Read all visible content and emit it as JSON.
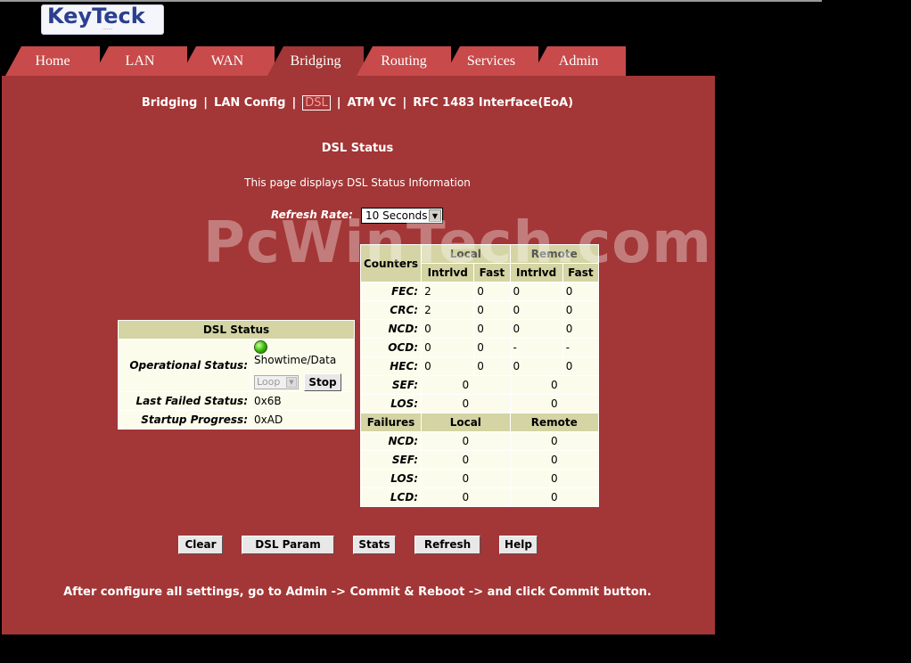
{
  "logo": {
    "text": "KeyTeck"
  },
  "tabs": [
    "Home",
    "LAN",
    "WAN",
    "Bridging",
    "Routing",
    "Services",
    "Admin"
  ],
  "subnav": {
    "bridging": "Bridging",
    "lan_config": "LAN Config",
    "dsl": "DSL",
    "atm_vc": "ATM VC",
    "rfc1483": "RFC 1483 Interface(EoA)",
    "separator": "|"
  },
  "page": {
    "title": "DSL Status",
    "description": "This page displays DSL Status Information",
    "refresh_label": "Refresh Rate:",
    "refresh_value": "10 Seconds"
  },
  "watermark": "PcWinTech.com",
  "dsl_status": {
    "header": "DSL Status",
    "operational_label": "Operational Status:",
    "operational_value": "Showtime/Data",
    "loop_value": "Loop",
    "stop_label": "Stop",
    "last_failed_label": "Last Failed Status:",
    "last_failed_value": "0x6B",
    "startup_label": "Startup Progress:",
    "startup_value": "0xAD"
  },
  "counters": {
    "header": "Counters",
    "local": "Local",
    "remote": "Remote",
    "intrlvd": "Intrlvd",
    "fast": "Fast",
    "rows": [
      {
        "label": "FEC:",
        "vals": [
          "2",
          "0",
          "0",
          "0"
        ]
      },
      {
        "label": "CRC:",
        "vals": [
          "2",
          "0",
          "0",
          "0"
        ]
      },
      {
        "label": "NCD:",
        "vals": [
          "0",
          "0",
          "0",
          "0"
        ]
      },
      {
        "label": "OCD:",
        "vals": [
          "0",
          "0",
          "-",
          "-"
        ]
      },
      {
        "label": "HEC:",
        "vals": [
          "0",
          "0",
          "0",
          "0"
        ]
      }
    ],
    "sef": {
      "label": "SEF:",
      "local": "0",
      "remote": "0"
    },
    "los": {
      "label": "LOS:",
      "local": "0",
      "remote": "0"
    }
  },
  "failures": {
    "header": "Failures",
    "local": "Local",
    "remote": "Remote",
    "rows": [
      {
        "label": "NCD:",
        "local": "0",
        "remote": "0"
      },
      {
        "label": "SEF:",
        "local": "0",
        "remote": "0"
      },
      {
        "label": "LOS:",
        "local": "0",
        "remote": "0"
      },
      {
        "label": "LCD:",
        "local": "0",
        "remote": "0"
      }
    ]
  },
  "buttons": {
    "clear": "Clear",
    "dsl_param": "DSL Param",
    "stats": "Stats",
    "refresh": "Refresh",
    "help": "Help"
  },
  "footer": "After configure all settings, go to Admin -> Commit & Reboot -> and click Commit button."
}
